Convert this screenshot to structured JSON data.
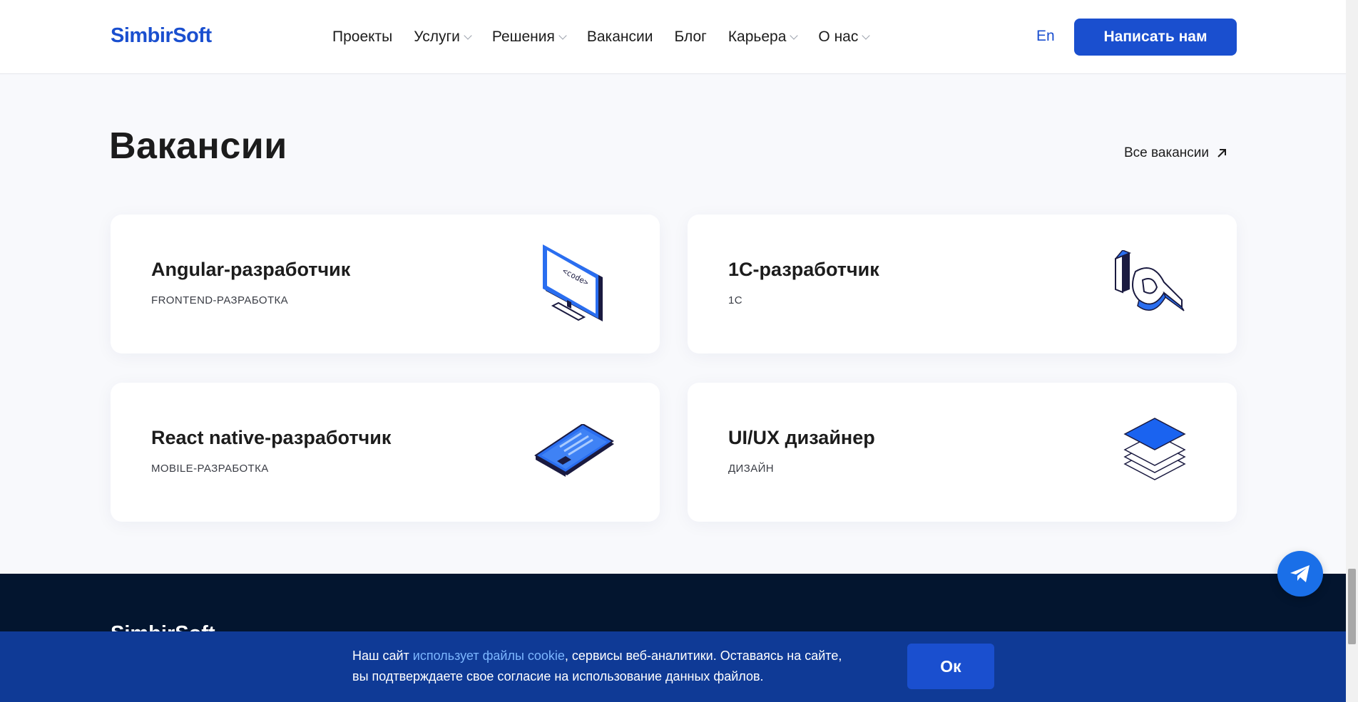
{
  "header": {
    "logo": "SimbirSoft",
    "nav": [
      {
        "label": "Проекты"
      },
      {
        "label": "Услуги"
      },
      {
        "label": "Решения"
      },
      {
        "label": "Вакансии"
      },
      {
        "label": "Блог"
      },
      {
        "label": "Карьера"
      },
      {
        "label": "О нас"
      }
    ],
    "lang": "En",
    "cta": "Написать нам"
  },
  "vacancies": {
    "title": "Вакансии",
    "all_link": "Все вакансии",
    "cards": [
      {
        "title": "Angular-разработчик",
        "tag": "FRONTEND-РАЗРАБОТКА",
        "icon": "monitor-code-icon",
        "icon_text": "<code>"
      },
      {
        "title": "1С-разработчик",
        "tag": "1С",
        "icon": "1c-logo-icon"
      },
      {
        "title": "React native-разработчик",
        "tag": "MOBILE-РАЗРАБОТКА",
        "icon": "smartphone-icon"
      },
      {
        "title": "UI/UX дизайнер",
        "tag": "ДИЗАЙН",
        "icon": "layers-icon"
      }
    ]
  },
  "footer": {
    "logo": "SimbirSoft"
  },
  "cookie": {
    "text_before": "Наш сайт ",
    "link": "использует файлы cookie",
    "text_after": ", сервисы веб-аналитики. Оставаясь на сайте, вы подтверждаете свое согласие на использование данных файлов.",
    "ok": "Ок"
  },
  "colors": {
    "brand": "#1a4fcf",
    "footer_bg": "#03152f",
    "cookie_bg": "#0f3a96",
    "telegram": "#1a6fe8"
  }
}
